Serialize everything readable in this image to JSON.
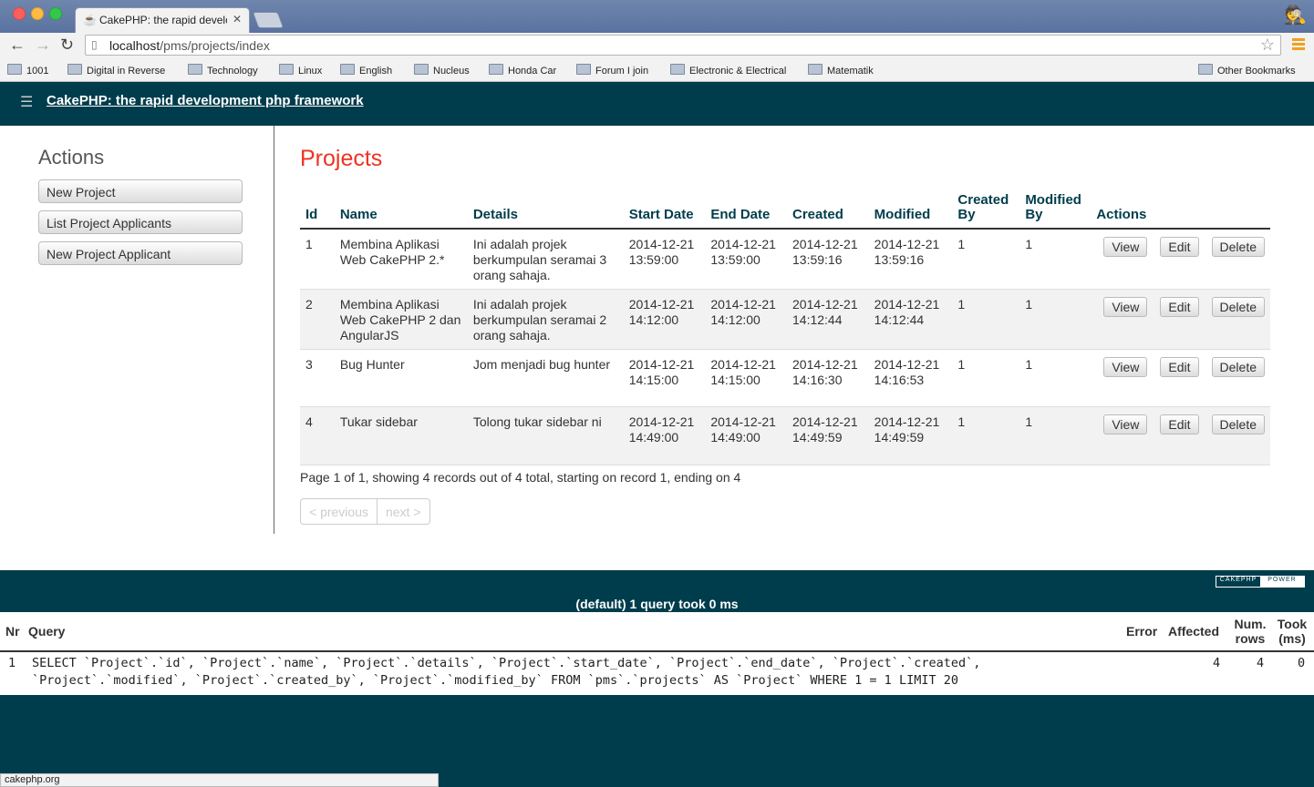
{
  "browser": {
    "tab_title": "CakePHP: the rapid development php framework",
    "url_host": "localhost",
    "url_path": "/pms/projects/index",
    "bookmarks": [
      "1001",
      "Digital in Reverse",
      "Technology",
      "Linux",
      "English",
      "Nucleus",
      "Honda Car",
      "Forum I join",
      "Electronic & Electrical",
      "Matematik"
    ],
    "other_bookmarks": "Other Bookmarks",
    "status_url": "cakephp.org"
  },
  "header": {
    "title": "CakePHP: the rapid development php framework"
  },
  "sidebar": {
    "heading": "Actions",
    "buttons": [
      "New Project",
      "List Project Applicants",
      "New Project Applicant"
    ]
  },
  "main": {
    "title": "Projects",
    "columns": [
      "Id",
      "Name",
      "Details",
      "Start Date",
      "End Date",
      "Created",
      "Modified",
      "Created By",
      "Modified By",
      "Actions"
    ],
    "rows": [
      {
        "id": "1",
        "name": "Membina Aplikasi Web CakePHP 2.*",
        "details": "Ini adalah projek berkumpulan seramai 3 orang sahaja.",
        "start_date": "2014-12-21 13:59:00",
        "end_date": "2014-12-21 13:59:00",
        "created": "2014-12-21 13:59:16",
        "modified": "2014-12-21 13:59:16",
        "created_by": "1",
        "modified_by": "1"
      },
      {
        "id": "2",
        "name": "Membina Aplikasi Web CakePHP 2 dan AngularJS",
        "details": "Ini adalah projek berkumpulan seramai 2 orang sahaja.",
        "start_date": "2014-12-21 14:12:00",
        "end_date": "2014-12-21 14:12:00",
        "created": "2014-12-21 14:12:44",
        "modified": "2014-12-21 14:12:44",
        "created_by": "1",
        "modified_by": "1"
      },
      {
        "id": "3",
        "name": "Bug Hunter",
        "details": "Jom menjadi bug hunter",
        "start_date": "2014-12-21 14:15:00",
        "end_date": "2014-12-21 14:15:00",
        "created": "2014-12-21 14:16:30",
        "modified": "2014-12-21 14:16:53",
        "created_by": "1",
        "modified_by": "1"
      },
      {
        "id": "4",
        "name": "Tukar sidebar",
        "details": "Tolong tukar sidebar ni",
        "start_date": "2014-12-21 14:49:00",
        "end_date": "2014-12-21 14:49:00",
        "created": "2014-12-21 14:49:59",
        "modified": "2014-12-21 14:49:59",
        "created_by": "1",
        "modified_by": "1"
      }
    ],
    "row_actions": {
      "view": "View",
      "edit": "Edit",
      "delete": "Delete"
    },
    "paging_text": "Page 1 of 1, showing 4 records out of 4 total, starting on record 1, ending on 4",
    "prev_label": "< previous",
    "next_label": "next >"
  },
  "sql_log": {
    "caption": "(default) 1 query took 0 ms",
    "badge_left": "CAKEPHP",
    "badge_right": "POWER",
    "headers": {
      "nr": "Nr",
      "query": "Query",
      "error": "Error",
      "affected": "Affected",
      "num_rows": "Num. rows",
      "took": "Took (ms)"
    },
    "row": {
      "nr": "1",
      "query_line1": "SELECT `Project`.`id`, `Project`.`name`, `Project`.`details`, `Project`.`start_date`, `Project`.`end_date`, `Project`.`created`,",
      "query_line2": "`Project`.`modified`, `Project`.`created_by`, `Project`.`modified_by` FROM `pms`.`projects` AS `Project` WHERE 1 = 1 LIMIT 20",
      "error": "",
      "affected": "4",
      "num_rows": "4",
      "took": "0"
    }
  },
  "colors": {
    "brand": "#003d4c",
    "title_red": "#e32"
  }
}
